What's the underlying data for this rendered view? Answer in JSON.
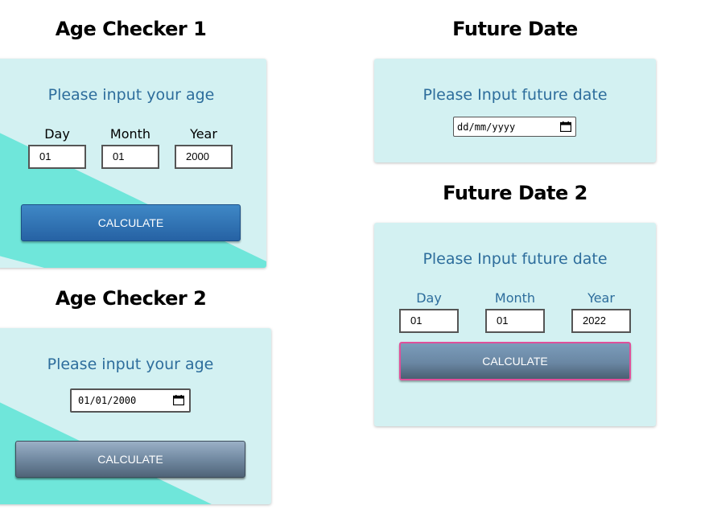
{
  "age_checker_1": {
    "title": "Age Checker 1",
    "prompt": "Please input your age",
    "day_label": "Day",
    "month_label": "Month",
    "year_label": "Year",
    "day_value": "01",
    "month_value": "01",
    "year_value": "2000",
    "button_label": "CALCULATE"
  },
  "age_checker_2": {
    "title": "Age Checker 2",
    "prompt": "Please input your age",
    "date_value": "01/01/2000",
    "button_label": "CALCULATE"
  },
  "future_date": {
    "title": "Future Date",
    "prompt": "Please Input future date",
    "date_placeholder": "dd/mm/yyyy"
  },
  "future_date_2": {
    "title": "Future Date 2",
    "prompt": "Please Input future date",
    "day_label": "Day",
    "month_label": "Month",
    "year_label": "Year",
    "day_value": "01",
    "month_value": "01",
    "year_value": "2022",
    "button_label": "CALCULATE"
  },
  "colors": {
    "card_bg": "#d3f1f2",
    "accent_teal": "#6fe6da",
    "prompt_blue": "#2d6d9c",
    "button_blue": "#2f74b7",
    "focus_pink": "#e0509a"
  },
  "icons": {
    "calendar": "calendar-icon"
  }
}
